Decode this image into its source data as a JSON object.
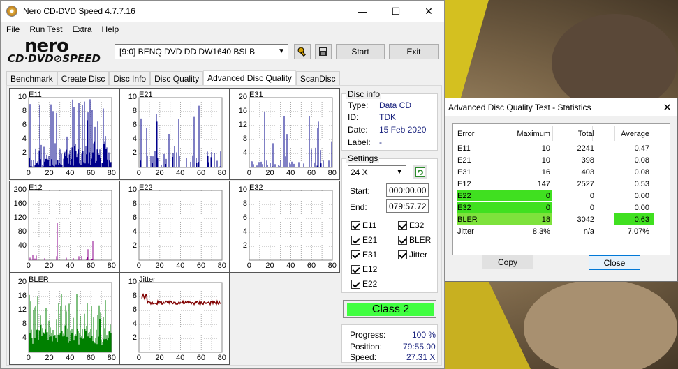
{
  "window": {
    "title": "Nero CD-DVD Speed 4.7.7.16",
    "minimize": "—",
    "maximize": "☐",
    "close": "✕"
  },
  "menu": [
    "File",
    "Run Test",
    "Extra",
    "Help"
  ],
  "logo": {
    "line1": "nero",
    "line2": "CD·DVD⊘SPEED"
  },
  "drive": {
    "value": "[9:0]   BENQ DVD DD DW1640 BSLB"
  },
  "buttons": {
    "start": "Start",
    "exit": "Exit"
  },
  "tabs": [
    "Benchmark",
    "Create Disc",
    "Disc Info",
    "Disc Quality",
    "Advanced Disc Quality",
    "ScanDisc"
  ],
  "active_tab": 4,
  "disc_info": {
    "title": "Disc info",
    "type_label": "Type:",
    "type": "Data CD",
    "id_label": "ID:",
    "id": "TDK",
    "date_label": "Date:",
    "date": "15 Feb 2020",
    "label_label": "Label:",
    "label": "-"
  },
  "settings": {
    "title": "Settings",
    "speed": "24 X",
    "start_label": "Start:",
    "start": "000:00.00",
    "end_label": "End:",
    "end": "079:57.72",
    "checks": [
      "E11",
      "E32",
      "E21",
      "BLER",
      "E31",
      "Jitter",
      "E12",
      "E22"
    ]
  },
  "class_badge": "Class 2",
  "progress": {
    "progress_label": "Progress:",
    "progress": "100 %",
    "position_label": "Position:",
    "position": "79:55.00",
    "speed_label": "Speed:",
    "speed": "27.31 X"
  },
  "colors": {
    "e_bars": "#00008b",
    "e12_bars": "#8b008b",
    "bler_bars": "#008000",
    "jitter_line": "#800000",
    "class_bg": "#40ff40",
    "highlight": "#40e020"
  },
  "chart_data": [
    {
      "type": "bar",
      "name": "E11",
      "ylim": [
        0,
        10
      ],
      "yticks": [
        "10",
        "8",
        "6",
        "4",
        "2"
      ],
      "xticks": [
        "0",
        "20",
        "40",
        "60",
        "80"
      ],
      "xlim": [
        0,
        80
      ]
    },
    {
      "type": "bar",
      "name": "E21",
      "ylim": [
        0,
        10
      ],
      "yticks": [
        "10",
        "8",
        "6",
        "4",
        "2"
      ],
      "xticks": [
        "0",
        "20",
        "40",
        "60",
        "80"
      ],
      "xlim": [
        0,
        80
      ]
    },
    {
      "type": "bar",
      "name": "E31",
      "ylim": [
        0,
        20
      ],
      "yticks": [
        "20",
        "16",
        "12",
        "8",
        "4"
      ],
      "xticks": [
        "0",
        "20",
        "40",
        "60",
        "80"
      ],
      "xlim": [
        0,
        80
      ]
    },
    {
      "type": "bar",
      "name": "E12",
      "ylim": [
        0,
        200
      ],
      "yticks": [
        "200",
        "160",
        "120",
        "80",
        "40"
      ],
      "xticks": [
        "0",
        "20",
        "40",
        "60",
        "80"
      ],
      "xlim": [
        0,
        80
      ]
    },
    {
      "type": "bar",
      "name": "E22",
      "ylim": [
        0,
        10
      ],
      "yticks": [
        "10",
        "8",
        "6",
        "4",
        "2"
      ],
      "xticks": [
        "0",
        "20",
        "40",
        "60",
        "80"
      ],
      "xlim": [
        0,
        80
      ]
    },
    {
      "type": "bar",
      "name": "E32",
      "ylim": [
        0,
        10
      ],
      "yticks": [
        "10",
        "8",
        "6",
        "4",
        "2"
      ],
      "xticks": [
        "0",
        "20",
        "40",
        "60",
        "80"
      ],
      "xlim": [
        0,
        80
      ]
    },
    {
      "type": "bar",
      "name": "BLER",
      "ylim": [
        0,
        20
      ],
      "yticks": [
        "20",
        "16",
        "12",
        "8",
        "4"
      ],
      "xticks": [
        "0",
        "20",
        "40",
        "60",
        "80"
      ],
      "xlim": [
        0,
        80
      ]
    },
    {
      "type": "line",
      "name": "Jitter",
      "ylim": [
        0,
        10
      ],
      "yticks": [
        "10",
        "8",
        "6",
        "4",
        "2"
      ],
      "xticks": [
        "0",
        "20",
        "40",
        "60",
        "80"
      ],
      "xlim": [
        0,
        80
      ]
    }
  ],
  "stats_dialog": {
    "title": "Advanced Disc Quality Test - Statistics",
    "close": "✕",
    "headers": [
      "Error",
      "Maximum",
      "Total",
      "Average"
    ],
    "rows": [
      [
        "E11",
        "10",
        "2241",
        "0.47"
      ],
      [
        "E21",
        "10",
        "398",
        "0.08"
      ],
      [
        "E31",
        "16",
        "403",
        "0.08"
      ],
      [
        "E12",
        "147",
        "2527",
        "0.53"
      ],
      [
        "E22",
        "0",
        "0",
        "0.00"
      ],
      [
        "E32",
        "0",
        "0",
        "0.00"
      ],
      [
        "BLER",
        "18",
        "3042",
        "0.63"
      ],
      [
        "Jitter",
        "8.3%",
        "n/a",
        "7.07%"
      ]
    ],
    "copy": "Copy",
    "close_button": "Close"
  }
}
